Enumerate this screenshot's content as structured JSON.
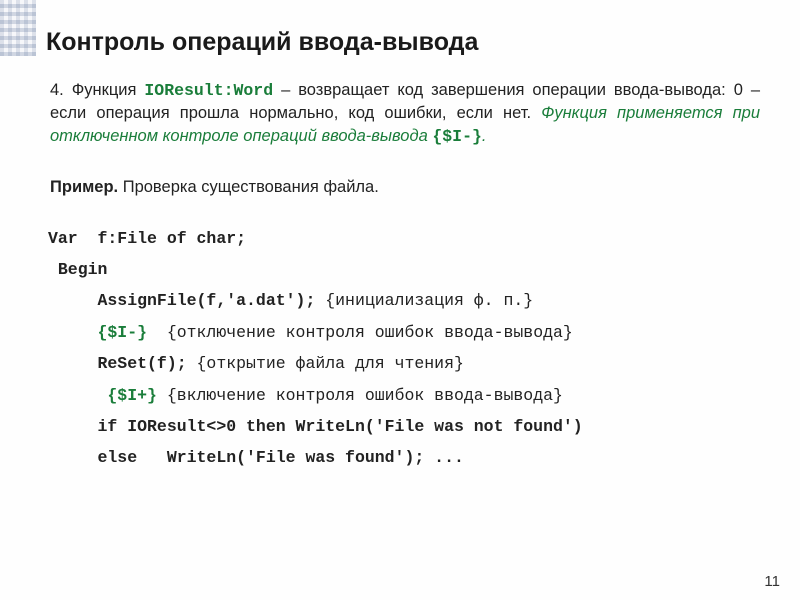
{
  "title": "Контроль операций ввода-вывода",
  "para": {
    "lead": "4. Функция ",
    "funcname": "IOResult:Word",
    "mid": " – возвращает код завершения операции ввода-вывода: 0 – если операция прошла нормально, код ошибки, если нет. ",
    "italic": "Функция применяется при отключенном контроле операций ввода-вывода ",
    "directive": "{$I-}",
    "tail": "."
  },
  "example": {
    "label": "Пример.",
    "text": " Проверка существования файла."
  },
  "code": {
    "l1": "Var  f:File of char;",
    "l2": " Begin",
    "l3a": "     AssignFile(f,'a.dat'); ",
    "l3c": "{инициализация ф. п.}",
    "l4a": "     {$I-}  ",
    "l4c": "{отключение контроля ошибок ввода-вывода}",
    "l5a": "     ReSet(f); ",
    "l5c": "{открытие файла для чтения}",
    "l6a": "      {$I+} ",
    "l6c": "{включение контроля ошибок ввода-вывода}",
    "l7": "     if IOResult<>0 then WriteLn('File was not found')",
    "l8": "     else   WriteLn('File was found'); ..."
  },
  "page_number": "11"
}
